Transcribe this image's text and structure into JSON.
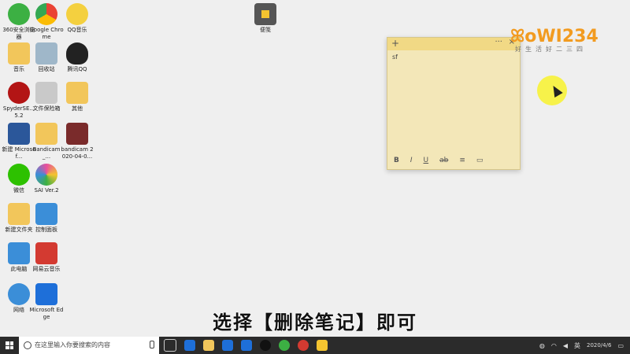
{
  "desktop_icons": [
    {
      "label": "360安全浏览器",
      "icon": "browser-360-icon",
      "color": "#3cb043"
    },
    {
      "label": "Google Chrome",
      "icon": "chrome-icon",
      "color": "#4285f4"
    },
    {
      "label": "QQ音乐",
      "icon": "qq-music-icon",
      "color": "#f4d03f"
    },
    {
      "label": "音乐",
      "icon": "folder-icon",
      "color": "#f2c65b"
    },
    {
      "label": "回收站",
      "icon": "recycle-bin-icon",
      "color": "#9fb7c9"
    },
    {
      "label": "腾讯QQ",
      "icon": "qq-penguin-icon",
      "color": "#222222"
    },
    {
      "label": "SpyderSE... 5.2",
      "icon": "spyder-icon",
      "color": "#b31515"
    },
    {
      "label": "文件保险箱",
      "icon": "file-vault-icon",
      "color": "#c9c9c9"
    },
    {
      "label": "其他",
      "icon": "folder-icon",
      "color": "#f2c65b"
    },
    {
      "label": "新建 Microsof...",
      "icon": "word-doc-icon",
      "color": "#2b579a"
    },
    {
      "label": "Bandicam_...",
      "icon": "folder-icon",
      "color": "#f2c65b"
    },
    {
      "label": "bandicam 2020-04-0...",
      "icon": "video-file-icon",
      "color": "#7a2b2b"
    },
    {
      "label": "微信",
      "icon": "wechat-icon",
      "color": "#2dc100"
    },
    {
      "label": "SAI Ver.2",
      "icon": "sai-icon",
      "color": "#e94f9d"
    },
    {
      "label": "新建文件夹",
      "icon": "folder-icon",
      "color": "#f2c65b"
    },
    {
      "label": "控制面板",
      "icon": "control-panel-icon",
      "color": "#3b8ed8"
    },
    {
      "label": "此电脑",
      "icon": "computer-icon",
      "color": "#3b8ed8"
    },
    {
      "label": "网易云音乐",
      "icon": "netease-music-icon",
      "color": "#d33a31"
    },
    {
      "label": "网络",
      "icon": "network-icon",
      "color": "#3b8ed8"
    },
    {
      "label": "Microsoft Edge",
      "icon": "edge-icon",
      "color": "#1e6fd9"
    }
  ],
  "sticky_shortcut": {
    "label": "便笺",
    "icon": "sticky-notes-icon",
    "color": "#f4c430"
  },
  "sticky_note": {
    "plus": "+",
    "more": "···",
    "close": "×",
    "content": "sf",
    "toolbar": [
      "B",
      "I",
      "U",
      "ab",
      "≡",
      "▭"
    ]
  },
  "watermark": {
    "brand": "ꕤoWI234",
    "sub": "好生活好二三四"
  },
  "subtitle": "选择【删除笔记】即可",
  "taskbar": {
    "search_placeholder": "在这里输入你要搜索的内容",
    "clock_time": "",
    "clock_date": "2020/4/6",
    "pinned": [
      {
        "icon": "task-view-icon",
        "color": "#cccccc"
      },
      {
        "icon": "store-icon",
        "color": "#1e6fd9"
      },
      {
        "icon": "explorer-icon",
        "color": "#f2c65b"
      },
      {
        "icon": "mail-icon",
        "color": "#1e6fd9"
      },
      {
        "icon": "edge-icon",
        "color": "#1e6fd9"
      },
      {
        "icon": "qq-penguin-icon",
        "color": "#222222"
      },
      {
        "icon": "browser-360-icon",
        "color": "#3cb043"
      },
      {
        "icon": "record-icon",
        "color": "#d33a31"
      },
      {
        "icon": "sticky-notes-icon",
        "color": "#f4c430"
      }
    ],
    "tray_text": "英"
  }
}
